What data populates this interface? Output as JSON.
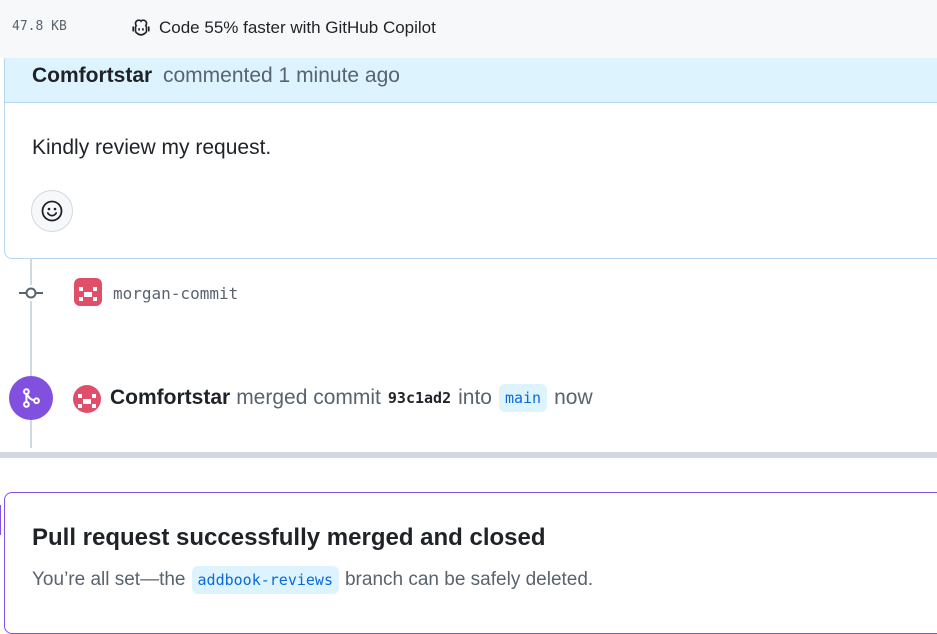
{
  "topbar": {
    "file_size": "47.8 KB",
    "copilot_label": "Code 55% faster with GitHub Copilot"
  },
  "comment": {
    "author": "Comfortstar",
    "meta": "commented 1 minute ago",
    "body": "Kindly review my request."
  },
  "commit": {
    "author": "morgan-commit"
  },
  "merge_event": {
    "author": "Comfortstar",
    "text_before": "merged commit",
    "sha": "93c1ad2",
    "text_into": "into",
    "target_branch": "main",
    "time": "now"
  },
  "merged_status": {
    "title": "Pull request successfully merged and closed",
    "desc_prefix": "You’re all set—the",
    "branch": "addbook-reviews",
    "desc_suffix": "branch can be safely deleted."
  },
  "colors": {
    "merged_purple": "#8250df",
    "comment_header_bg": "#ddf4ff",
    "link_blue": "#0969da"
  },
  "icons": [
    "copilot-icon",
    "smiley-icon",
    "commit-icon",
    "merge-icon",
    "avatar-identicon"
  ]
}
